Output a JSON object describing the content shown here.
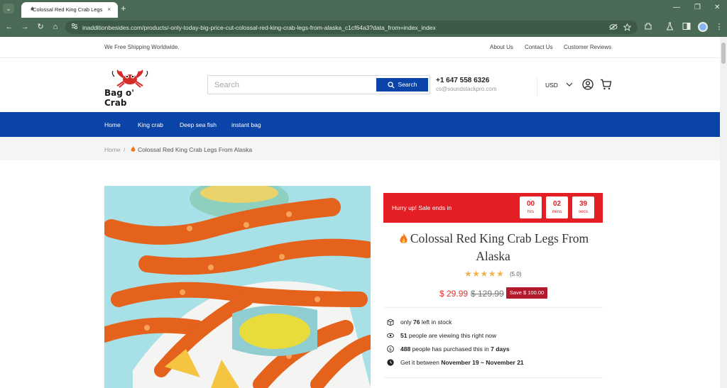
{
  "browser": {
    "tab_title": "Colossal Red King Crab Legs",
    "url": "inadditionbesides.com/products/-only-today-big-price-cut-colossal-red-king-crab-legs-from-alaska_c1cf64a3?data_from=index_index",
    "tab_close": "×",
    "new_tab": "+",
    "win_min": "—",
    "win_max": "❐",
    "win_close": "✕",
    "menu_glyph": "⌄",
    "back": "←",
    "forward": "→",
    "reload": "↻",
    "home": "⌂",
    "more": "⋮"
  },
  "topbar": {
    "shipping": "We Free Shipping Worldwide.",
    "links": [
      "About Us",
      "Contact Us",
      "Customer Reviews"
    ]
  },
  "header": {
    "logo_text": "Bag o' Crab",
    "search_placeholder": "Search",
    "search_button": "Search",
    "phone": "+1 647 558 6326",
    "email": "cs@soundstackpro.com",
    "currency": "USD"
  },
  "nav": {
    "items": [
      "Home",
      "King crab",
      "Deep sea fish",
      "instant bag"
    ]
  },
  "breadcrumb": {
    "home": "Home",
    "separator": "/",
    "current": "Colossal Red King Crab Legs From Alaska"
  },
  "product": {
    "sale_text": "Hurry up!  Sale ends in",
    "countdown": [
      {
        "value": "00",
        "label": "hrs"
      },
      {
        "value": "02",
        "label": "mins"
      },
      {
        "value": "39",
        "label": "secs"
      }
    ],
    "title": "Colossal Red King Crab Legs From Alaska",
    "stars": "★★★★★",
    "rating": "(5.0)",
    "price": "$ 29.99",
    "old_price": "$ 129.99",
    "save": "Save $ 100.00",
    "stock_pre": "only",
    "stock_num": "76",
    "stock_post": "left in stock",
    "viewing_num": "51",
    "viewing_text": "people are viewing this right now",
    "purchased_num": "488",
    "purchased_text": "people has purchased this in",
    "purchased_days": "7 days",
    "delivery_pre": "Get it between",
    "delivery_range": "November 19 ~ November 21"
  },
  "colors": {
    "nav_blue": "#0b44a8",
    "sale_red": "#e31e24",
    "price_red": "#e0332f",
    "save_badge": "#b4182c",
    "browser_green": "#4b6a55"
  }
}
